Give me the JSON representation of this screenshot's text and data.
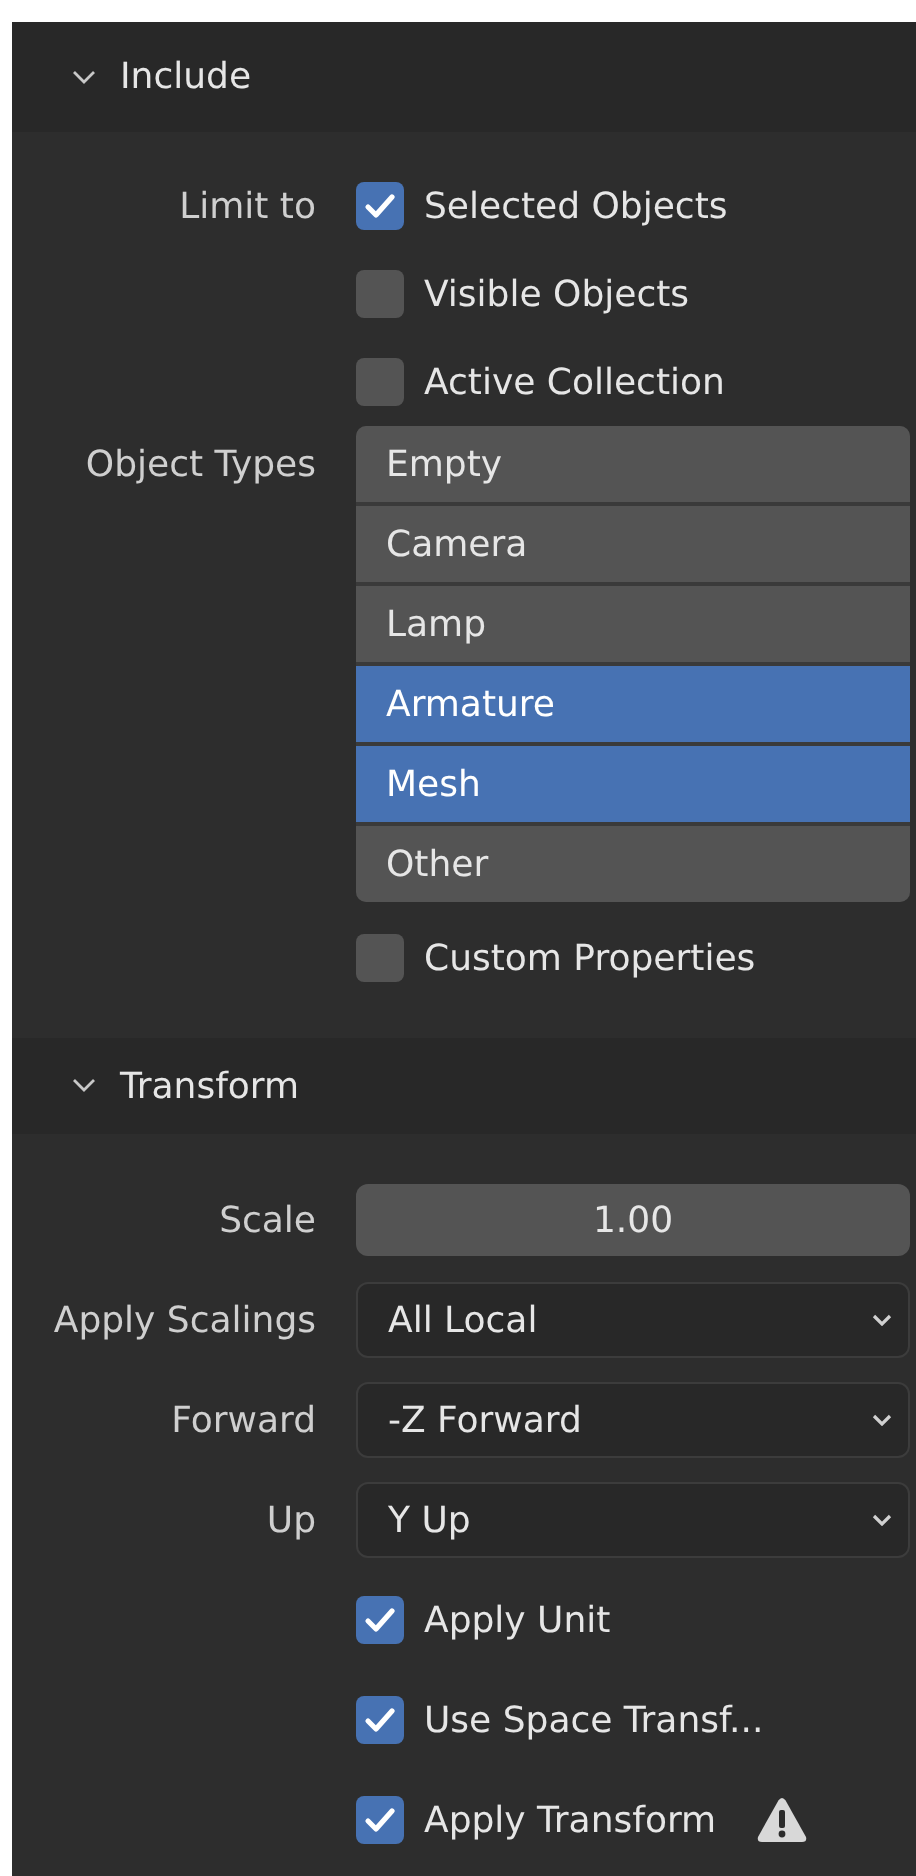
{
  "sections": [
    {
      "title": "Include",
      "expanded": true,
      "rows": [
        {
          "kind": "checkbox",
          "label": "Limit to",
          "text": "Selected Objects",
          "checked": true
        },
        {
          "kind": "checkbox",
          "text": "Visible Objects",
          "checked": false
        },
        {
          "kind": "checkbox",
          "text": "Active Collection",
          "checked": false
        },
        {
          "kind": "list",
          "label": "Object Types",
          "items": [
            {
              "text": "Empty",
              "selected": false
            },
            {
              "text": "Camera",
              "selected": false
            },
            {
              "text": "Lamp",
              "selected": false
            },
            {
              "text": "Armature",
              "selected": true
            },
            {
              "text": "Mesh",
              "selected": true
            },
            {
              "text": "Other",
              "selected": false
            }
          ]
        },
        {
          "kind": "checkbox",
          "text": "Custom Properties",
          "checked": false
        }
      ]
    },
    {
      "title": "Transform",
      "expanded": true,
      "rows": [
        {
          "kind": "number",
          "label": "Scale",
          "value": "1.00"
        },
        {
          "kind": "dropdown",
          "label": "Apply Scalings",
          "value": "All Local"
        },
        {
          "kind": "dropdown",
          "label": "Forward",
          "value": "-Z Forward"
        },
        {
          "kind": "dropdown",
          "label": "Up",
          "value": "Y Up"
        },
        {
          "kind": "checkbox",
          "text": "Apply Unit",
          "checked": true
        },
        {
          "kind": "checkbox",
          "text": "Use Space Transf...",
          "checked": true
        },
        {
          "kind": "checkbox",
          "text": "Apply Transform",
          "checked": true,
          "warning": true
        }
      ]
    }
  ]
}
